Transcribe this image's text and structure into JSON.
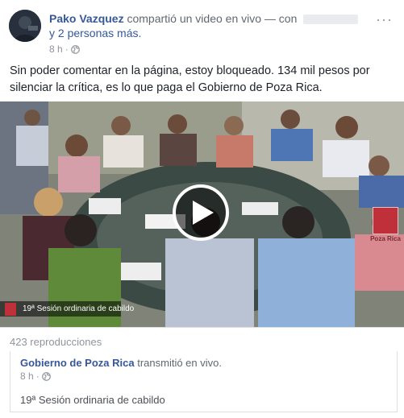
{
  "post": {
    "author": "Pako Vazquez",
    "action": "compartió un video en vivo — con",
    "with_more": "y 2 personas más.",
    "time": "8 h",
    "separator": "·",
    "menu": "···",
    "text": "Sin poder comentar en la página, estoy bloqueado. 134 mil pesos por silenciar la crítica, es lo que paga el Gobierno de Poza Rica."
  },
  "video": {
    "overlay_caption": "19ª Sesión ordinaria de cabildo",
    "corner_logo_text": "Poza Rica",
    "views": "423 reproducciones"
  },
  "shared": {
    "author": "Gobierno de Poza Rica",
    "action": "transmitió en vivo.",
    "time": "8 h",
    "separator": "·",
    "title": "19ª Sesión ordinaria de cabildo"
  },
  "colors": {
    "link": "#365899",
    "meta": "#90949c",
    "text": "#1d2129",
    "brand_red": "#c0303a"
  },
  "icons": {
    "globe": "globe-icon",
    "play": "play-icon",
    "menu": "more-options-icon"
  }
}
